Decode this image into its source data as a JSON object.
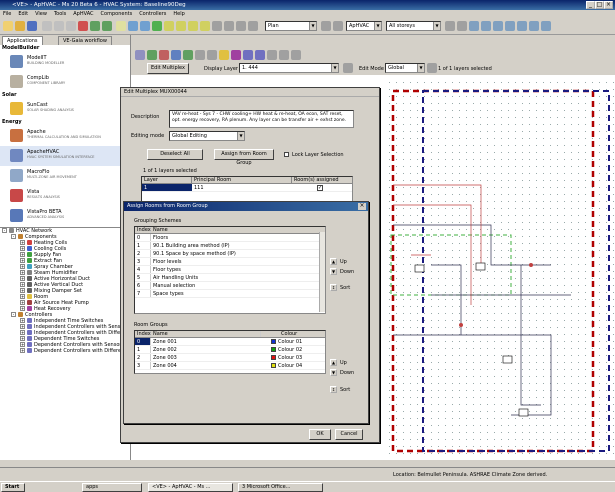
{
  "window": {
    "title": "<VE> - ApHVAC - Ms 20 Beta 6 - HVAC System: Baseline90Deg"
  },
  "menu": [
    "File",
    "Edit",
    "View",
    "Tools",
    "ApHVAC",
    "Components",
    "Controllers",
    "Help"
  ],
  "toolbar": {
    "plan_mode": "Plan",
    "app_combo": "ApHVAC",
    "storeys": "All storeys"
  },
  "canvas_toolbar": {
    "edit_multiplex_label": "Edit Multiplex",
    "display_layer_label": "Display Layer",
    "display_layer_value": "1. 444",
    "edit_mode_label": "Edit Mode",
    "edit_mode_value": "Global",
    "layers_status": "1 of 1 layers selected"
  },
  "left_tabs": [
    "Applications",
    "VE-Gaia workflow"
  ],
  "model_builder": {
    "heading": "ModelBuilder",
    "apps": [
      {
        "name": "ModelIT",
        "desc": "BUILDING MODELLER",
        "color": "#6a88b8"
      },
      {
        "name": "CompLib",
        "desc": "COMPONENT LIBRARY",
        "color": "#b8b0a0"
      }
    ]
  },
  "solar": {
    "heading": "Solar",
    "apps": [
      {
        "name": "SunCast",
        "desc": "SOLAR SHADING ANALYSIS",
        "color": "#e8b838"
      }
    ]
  },
  "energy": {
    "heading": "Energy",
    "apps": [
      {
        "name": "Apache",
        "desc": "THERMAL CALCULATION AND SIMULATION",
        "color": "#c87040"
      },
      {
        "name": "ApacheHVAC",
        "desc": "HVAC SYSTEM SIMULATION INTERFACE",
        "color": "#7088c0"
      },
      {
        "name": "MacroFlo",
        "desc": "MULTI-ZONE AIR MOVEMENT",
        "color": "#90a8c8"
      },
      {
        "name": "Vista",
        "desc": "RESULTS ANALYSIS",
        "color": "#c84848"
      },
      {
        "name": "VistaPro BETA",
        "desc": "ADVANCED ANALYSIS",
        "color": "#5878b8"
      }
    ]
  },
  "tree": [
    {
      "label": "HVAC Network",
      "indent": 0,
      "expander": "-",
      "color": "#888"
    },
    {
      "label": "Components",
      "indent": 1,
      "expander": "-",
      "color": "#c08030"
    },
    {
      "label": "Heating Coils",
      "indent": 2,
      "expander": "+",
      "color": "#d04040"
    },
    {
      "label": "Cooling Coils",
      "indent": 2,
      "expander": "+",
      "color": "#4060d0"
    },
    {
      "label": "Supply Fan",
      "indent": 2,
      "expander": "+",
      "color": "#40a040"
    },
    {
      "label": "Extract Fan",
      "indent": 2,
      "expander": "+",
      "color": "#40a040"
    },
    {
      "label": "Spray Chamber",
      "indent": 2,
      "expander": "+",
      "color": "#40a0c0"
    },
    {
      "label": "Steam Humidifier",
      "indent": 2,
      "expander": "+",
      "color": "#808080"
    },
    {
      "label": "Active Horizontal Duct",
      "indent": 2,
      "expander": "+",
      "color": "#606060"
    },
    {
      "label": "Active Vertical Duct",
      "indent": 2,
      "expander": "+",
      "color": "#606060"
    },
    {
      "label": "Mixing Damper Set",
      "indent": 2,
      "expander": "+",
      "color": "#606060"
    },
    {
      "label": "Room",
      "indent": 2,
      "expander": "+",
      "color": "#e0c040"
    },
    {
      "label": "Air Source Heat Pump",
      "indent": 2,
      "expander": "+",
      "color": "#a04040"
    },
    {
      "label": "Heat Recovery",
      "indent": 2,
      "expander": "+",
      "color": "#a040a0"
    },
    {
      "label": "Controllers",
      "indent": 1,
      "expander": "-",
      "color": "#c08030"
    },
    {
      "label": "Independent Time Switches",
      "indent": 2,
      "expander": "+",
      "color": "#7070c0"
    },
    {
      "label": "Independent Controllers with Sensors",
      "indent": 2,
      "expander": "+",
      "color": "#7070c0"
    },
    {
      "label": "Independent Controllers with Differenti",
      "indent": 2,
      "expander": "+",
      "color": "#7070c0"
    },
    {
      "label": "Dependent Time Switches",
      "indent": 2,
      "expander": "+",
      "color": "#7070c0"
    },
    {
      "label": "Dependent Controllers with Sensors",
      "indent": 2,
      "expander": "+",
      "color": "#7070c0"
    },
    {
      "label": "Dependent Controllers with Differentia",
      "indent": 2,
      "expander": "+",
      "color": "#7070c0"
    }
  ],
  "edit_dialog": {
    "title": "Edit Multiplex MUX00044",
    "description_label": "Description",
    "description": "VAV re-heat - Sys 7 - CHW cooling+ HW heat & re-heat, OA econ, SAT reset, opt. energy recovery, RA plenum. Any layer can be transfer air + exhst zone.",
    "editing_mode_label": "Editing mode",
    "editing_mode": "Global Editing",
    "deselect_all": "Deselect All",
    "assign_from_room_group": "Assign from Room Group",
    "lock_layer_selection": "Lock Layer Selection",
    "layers_status": "1 of 1 layers selected",
    "layer_columns": [
      "Layer",
      "Principal Room",
      "Room(s) assigned"
    ],
    "layers": [
      {
        "layer": "1",
        "room": "111",
        "assigned": true
      }
    ],
    "ok": "OK",
    "cancel": "Cancel"
  },
  "assign_dialog": {
    "title": "Assign Rooms from Room Group",
    "grouping_heading": "Grouping Schemes",
    "grouping_columns": [
      "Index",
      "Name"
    ],
    "schemes": [
      {
        "index": "0",
        "name": "Floors"
      },
      {
        "index": "1",
        "name": "90.1 Building area method (IP)"
      },
      {
        "index": "2",
        "name": "90.1 Space by space method (IP)"
      },
      {
        "index": "3",
        "name": "Floor levels"
      },
      {
        "index": "4",
        "name": "Floor types"
      },
      {
        "index": "5",
        "name": "Air Handling Units"
      },
      {
        "index": "6",
        "name": "Manual selection"
      },
      {
        "index": "7",
        "name": "Space types"
      }
    ],
    "room_groups_heading": "Room Groups",
    "group_columns": [
      "Index",
      "Name",
      "Colour"
    ],
    "groups": [
      {
        "index": "0",
        "name": "Zone 001",
        "colour": "Colour 01",
        "swatch": "#1030d0"
      },
      {
        "index": "1",
        "name": "Zone 002",
        "colour": "Colour 02",
        "swatch": "#10a010"
      },
      {
        "index": "2",
        "name": "Zone 003",
        "colour": "Colour 03",
        "swatch": "#e01010"
      },
      {
        "index": "3",
        "name": "Zone 004",
        "colour": "Colour 04",
        "swatch": "#e0e010"
      }
    ],
    "up": "Up",
    "down": "Down",
    "sort": "Sort"
  },
  "status_bar": {
    "location": "Location: Belmullet Peninsula. ASHRAE Climate Zone derived."
  },
  "taskbar": {
    "start": "Start",
    "items": [
      "apps",
      "<VE> - ApHVAC - Ms ...",
      "3 Microsoft Office..."
    ]
  }
}
